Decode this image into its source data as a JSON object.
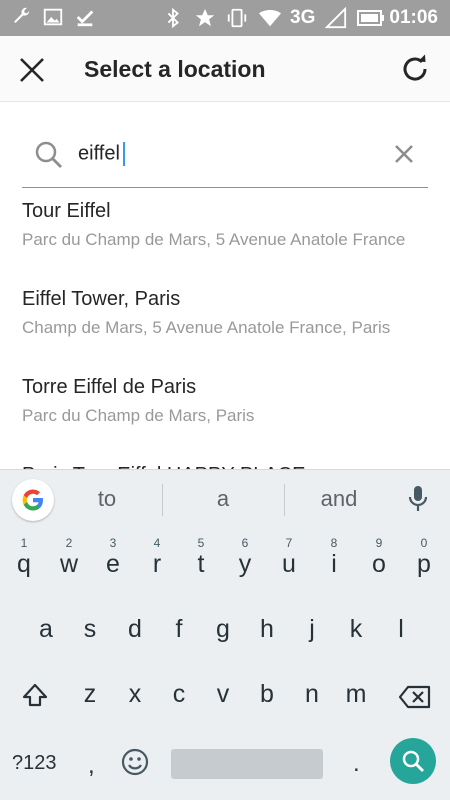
{
  "status_bar": {
    "network": "3G",
    "time": "01:06"
  },
  "app_bar": {
    "title": "Select a location"
  },
  "search": {
    "query": "eiffel"
  },
  "results": [
    {
      "name": "Tour Eiffel",
      "address": "Parc du Champ de Mars, 5 Avenue Anatole France"
    },
    {
      "name": "Eiffel Tower, Paris",
      "address": "Champ de Mars, 5 Avenue Anatole France, Paris"
    },
    {
      "name": "Torre Eiffel de Paris",
      "address": "Parc du Champ de Mars, Paris"
    },
    {
      "name": "Paris Tour Eiffel HAPPY PLACE",
      "address": ""
    }
  ],
  "keyboard": {
    "suggestions": [
      "to",
      "a",
      "and"
    ],
    "row1": [
      {
        "ch": "q",
        "num": "1"
      },
      {
        "ch": "w",
        "num": "2"
      },
      {
        "ch": "e",
        "num": "3"
      },
      {
        "ch": "r",
        "num": "4"
      },
      {
        "ch": "t",
        "num": "5"
      },
      {
        "ch": "y",
        "num": "6"
      },
      {
        "ch": "u",
        "num": "7"
      },
      {
        "ch": "i",
        "num": "8"
      },
      {
        "ch": "o",
        "num": "9"
      },
      {
        "ch": "p",
        "num": "0"
      }
    ],
    "row2": [
      "a",
      "s",
      "d",
      "f",
      "g",
      "h",
      "j",
      "k",
      "l"
    ],
    "row3": [
      "z",
      "x",
      "c",
      "v",
      "b",
      "n",
      "m"
    ],
    "symbols_label": "?123",
    "comma": ",",
    "period": "."
  },
  "colors": {
    "status_bar": "#9e9e9e",
    "accent": "#3897f0",
    "search_fab": "#26a69a",
    "keyboard_bg": "#eceff1"
  }
}
